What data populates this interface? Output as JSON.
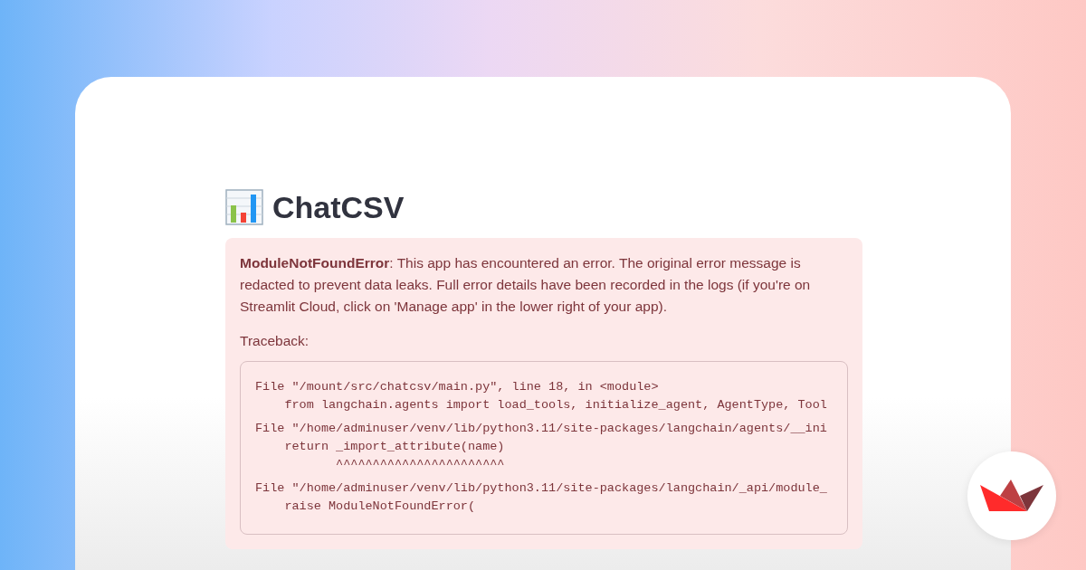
{
  "title": "ChatCSV",
  "alert": {
    "message": "**ModuleNotFoundError**: This app has encountered an error. The original error message is redacted to prevent data leaks. Full error details have been recorded in the logs (if you're on Streamlit Cloud, click on 'Manage app' in the lower right of your app).",
    "traceback_label": "Traceback:",
    "frames": [
      {
        "location": "File \"/mount/src/chatcsv/main.py\", line 18, in <module>",
        "code": [
          "    from langchain.agents import load_tools, initialize_agent, AgentType, Tool"
        ]
      },
      {
        "location": "File \"/home/adminuser/venv/lib/python3.11/site-packages/langchain/agents/__ini",
        "code": [
          "    return _import_attribute(name)",
          "           ^^^^^^^^^^^^^^^^^^^^^^^"
        ]
      },
      {
        "location": "File \"/home/adminuser/venv/lib/python3.11/site-packages/langchain/_api/module_",
        "code": [
          "    raise ModuleNotFoundError("
        ]
      }
    ]
  }
}
